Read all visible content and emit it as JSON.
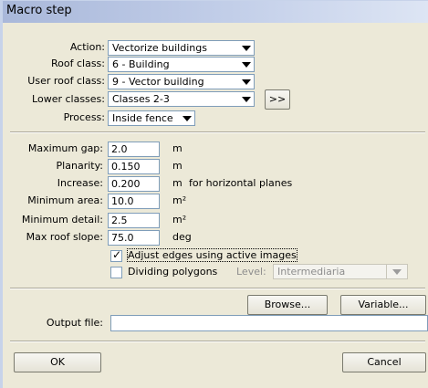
{
  "window": {
    "title": "Macro step"
  },
  "settings": {
    "action": {
      "label": "Action:",
      "value": "Vectorize buildings"
    },
    "roof_class": {
      "label": "Roof class:",
      "value": "6 - Building"
    },
    "user_roof_class": {
      "label": "User roof class:",
      "value": "9 - Vector building"
    },
    "lower_classes": {
      "label": "Lower classes:",
      "value": "Classes 2-3",
      "more_button": ">>"
    },
    "process": {
      "label": "Process:",
      "value": "Inside fence"
    }
  },
  "parameters": {
    "maximum_gap": {
      "label": "Maximum gap:",
      "value": "2.0",
      "unit": "m"
    },
    "planarity": {
      "label": "Planarity:",
      "value": "0.150",
      "unit": "m"
    },
    "increase": {
      "label": "Increase:",
      "value": "0.200",
      "unit": "m",
      "note": "for horizontal planes"
    },
    "minimum_area": {
      "label": "Minimum area:",
      "value": "10.0",
      "unit": "m²"
    },
    "minimum_detail": {
      "label": "Minimum detail:",
      "value": "2.5",
      "unit": "m²"
    },
    "max_roof_slope": {
      "label": "Max roof slope:",
      "value": "75.0",
      "unit": "deg"
    }
  },
  "options": {
    "adjust_edges": {
      "label": "Adjust edges using active images",
      "checked": true
    },
    "dividing_polygons": {
      "label": "Dividing polygons",
      "checked": false
    },
    "level": {
      "label": "Level:",
      "value": "Intermediaria"
    }
  },
  "output": {
    "browse_label": "Browse...",
    "variable_label": "Variable...",
    "file_label": "Output file:",
    "file_value": ""
  },
  "footer": {
    "ok_label": "OK",
    "cancel_label": "Cancel"
  },
  "colors": {
    "title_gradient_start": "#a9b8da",
    "dialog_bg": "#ece9d8",
    "field_border": "#7f9db9"
  }
}
